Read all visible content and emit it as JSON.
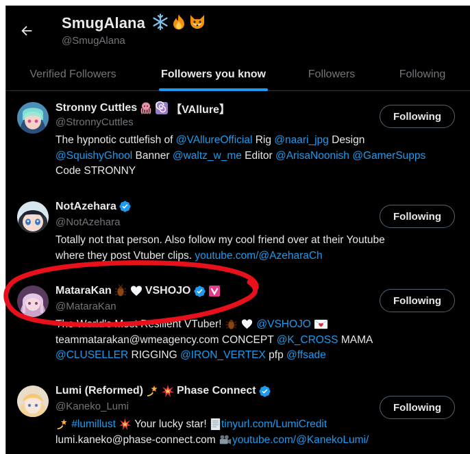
{
  "profile": {
    "name": "SmugAlana",
    "handle": "@SmugAlana"
  },
  "tabs": [
    {
      "label": "Verified Followers"
    },
    {
      "label": "Followers you know"
    },
    {
      "label": "Followers"
    },
    {
      "label": "Following"
    }
  ],
  "users": [
    {
      "name": "Stronny Cuttles",
      "name_suffix": "【VAllure】",
      "handle": "@StronnyCuttles",
      "button": "Following",
      "bio": {
        "l1_a": "The hypnotic cuttlefish of ",
        "l1_b": "@VAllureOfficial",
        "l1_c": " Rig ",
        "l1_d": "@naari_jpg",
        "l1_e": " Design",
        "l2_a": "@SquishyGhool",
        "l2_b": " Banner ",
        "l2_c": "@waltz_w_me",
        "l2_d": " Editor ",
        "l2_e": "@ArisaNoonish",
        "l2_f": " ",
        "l2_g": "@GamerSupps",
        "l3_a": "Code STRONNY"
      }
    },
    {
      "name": "NotAzehara",
      "handle": "@NotAzehara",
      "button": "Following",
      "bio": {
        "l1_a": "Totally not that person. Also follow my cool friend over at their Youtube",
        "l2_a": "where they post Vtuber clips. ",
        "l2_b": "youtube.com/@AzeharaCh"
      }
    },
    {
      "name": "MataraKan",
      "name_suffix": "VSHOJO",
      "handle": "@MataraKan",
      "button": "Following",
      "bio": {
        "l1_a": "The World's Most Resilient VTuber! ",
        "l1_b": "@VSHOJO",
        "l2_a": "teammatarakan@wmeagency.com CONCEPT ",
        "l2_b": "@K_CROSS",
        "l2_c": " MAMA",
        "l3_a": "@CLUSELLER",
        "l3_b": " RIGGING ",
        "l3_c": "@IRON_VERTEX",
        "l3_d": " pfp ",
        "l3_e": "@ffsade"
      }
    },
    {
      "name": "Lumi (Reformed)",
      "name_suffix": "Phase Connect",
      "handle": "@Kaneko_Lumi",
      "button": "Following",
      "bio": {
        "l1_a": "#lumillust",
        "l1_b": " Your lucky star! ",
        "l1_c": "tinyurl.com/LumiCredit",
        "l2_a": "lumi.kaneko@phase-connect.com ",
        "l2_b": "youtube.com/@KanekoLumi/"
      }
    }
  ],
  "colors": {
    "accent": "#1d9bf0",
    "background": "#000000",
    "text": "#e7e9ea",
    "muted": "#71767b",
    "annotation": "#e8101a"
  }
}
